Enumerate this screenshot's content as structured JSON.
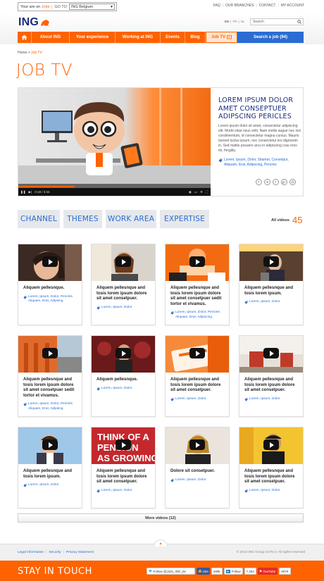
{
  "topbar": {
    "you_are_on_prefix": "Your are on",
    "you_are_on_site": "Jobs",
    "goto_label": "GO TO",
    "country_select": "ING Belgium",
    "util_links": [
      "FAQ",
      "OUR BRANCHES",
      "CONTACT",
      "MY ACCOUNT"
    ]
  },
  "header": {
    "logo_text": "ING",
    "languages": [
      "EN",
      "FR",
      "NL"
    ],
    "active_language": "EN",
    "search_placeholder": "Search"
  },
  "nav": {
    "items": [
      "About ING",
      "Your experience",
      "Working at ING",
      "Events",
      "Blog",
      "Job TV"
    ],
    "active": "Job TV",
    "job_search": "Search a job (94)",
    "colors": {
      "primary": "#ff6200",
      "accent": "#2a6cd2"
    }
  },
  "breadcrumb": {
    "home": "Home",
    "separator": ">",
    "current": "Job TV"
  },
  "page_title": "JOB TV",
  "featured": {
    "time": "0:18 / 3:34",
    "title": "LOREM IPSUM DOLOR AMET CONSEPTUER ADIPSCING PERICLES",
    "description": "Lorem ipsum dolor sit amet, consectetur adipiscing elit. Morbi vitae risus velit. Nam mollis augue nec nisi condimentum, id consectetur magna cursus. Mauris laoreet luctus ipsum, nec consectetur leo dignissim in. Sed mattis posuere arcu in adipiscing cras eros mi, fringilla.",
    "tags": "Lorem, Ipsum, Dolor, Sitamet, Consetpur, Aliquam, Erat, Adipscing, Pericles",
    "share_icons": [
      "f",
      "in",
      "t",
      "g+",
      "@"
    ]
  },
  "filters": {
    "tabs": [
      "CHANNEL",
      "THEMES",
      "WORK AREA",
      "EXPERTISE"
    ],
    "all_videos_label": "All videos",
    "all_videos_count": "45"
  },
  "videos": [
    {
      "title": "Aliquem pellesnque.",
      "tags": "Lorem, Ipsum, Dolor, Pericles Aliquam, Erat, Adipsing"
    },
    {
      "title": "Aliquem pellesnque and tosis lorem ipsum dolore sit amet consetpuer.",
      "tags": "Lorem, Ipsum, Dolor"
    },
    {
      "title": "Aliquem pellesnque and tosis lorem ipsum dolore sit amet consetpuer sedit tortor et vivamus.",
      "tags": "Lorem, Ipsum, Dolor, Pericles Aliquam, Erat, Adipscing"
    },
    {
      "title": "Aliquem pellesnque and tosis lorem ipsum.",
      "tags": "Lorem, Ipsum, Dolor"
    },
    {
      "title": "Aliquem pellesnque and tosis lorem ipsum dolore sit amet consetpuer sedit tortor et vivamus.",
      "tags": "Lorem, Ipsum, Dolor, Pericles Aliquam, Erat, Adipsing"
    },
    {
      "title": "Aliquem pellesnque.",
      "tags": "Lorem, Ipsum, Dolor"
    },
    {
      "title": "Aliquem pellesnque and tosis lorem ipsum dolore sit amet consetpuer.",
      "tags": "Lorem, Ipsum, Dolor"
    },
    {
      "title": "Aliquem pellesnque and tosis lorem ipsum dolore sit amet consetpuer.",
      "tags": "Lorem, Ipsum, Dolor"
    },
    {
      "title": "Aliquem pellesnque and tosis lorem ipsum.",
      "tags": "Lorem, Ipsum, Dolor"
    },
    {
      "title": "Aliquem pellesnque and tosis lorem ipsum dolore sit amet consetpuer.",
      "tags": "Lorem, Ipsum, Dolor"
    },
    {
      "title": "Dolore sit consetpuer.",
      "tags": "Lorem, Ipsum, Dolor"
    },
    {
      "title": "Aliquem pellesnque and tosis lorem ipsum dolore sit amet consetpuer.",
      "tags": "Lorem, Ipsum, Dolor"
    }
  ],
  "more_button": "More videos (12)",
  "footer": {
    "links": [
      "Legal Information",
      "Security",
      "Privacy Statement"
    ],
    "copyright": "© 2013 ING Group SA/N.V. All rights reserved"
  },
  "stay": {
    "label": "STAY IN TOUCH",
    "twitter": "Follow @Jobs_ING_be",
    "facebook_label": "Like",
    "facebook_count": "280k",
    "linkedin_label": "Follow",
    "linkedin_count": "7,252",
    "youtube_label": "YouTube",
    "youtube_count": "487K"
  }
}
